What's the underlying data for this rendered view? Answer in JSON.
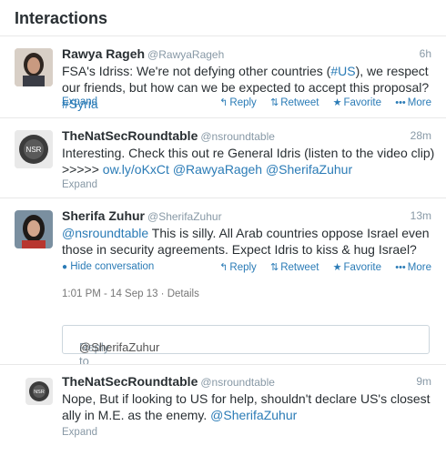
{
  "header": {
    "title": "Interactions"
  },
  "tweets": [
    {
      "name": "Rawya Rageh",
      "handle": "@RawyaRageh",
      "time": "6h",
      "text_parts": [
        "FSA's Idriss: We're not defying other countries (",
        "#US",
        "), we respect our friends, but how can we be expected to accept this proposal? ",
        "#Syria"
      ],
      "expand": "Expand",
      "actions": {
        "reply": "Reply",
        "retweet": "Retweet",
        "favorite": "Favorite",
        "more": "More"
      }
    },
    {
      "name": "TheNatSecRoundtable",
      "handle": "@nsroundtable",
      "time": "28m",
      "line1": "Interesting. Check this out re General Idris (listen to the video clip)",
      "line2_prefix": ">>>>> ",
      "link": "ow.ly/oKxCt",
      "mention1": "@RawyaRageh",
      "mention2": "@SherifaZuhur",
      "expand": "Expand",
      "avatar_text": "NSR"
    },
    {
      "name": "Sherifa Zuhur",
      "handle": "@SherifaZuhur",
      "time": "13m",
      "mention": "@nsroundtable",
      "text_rest": " This is silly.  All Arab countries oppose Israel even those in security agreements. Expect Idris to kiss & hug Israel?",
      "hide": "Hide conversation",
      "actions": {
        "reply": "Reply",
        "retweet": "Retweet",
        "favorite": "Favorite",
        "more": "More"
      },
      "meta": "1:01 PM - 14 Sep 13 · Details",
      "reply_prefix": "Reply to ",
      "reply_mention": "@SherifaZuhur"
    },
    {
      "name": "TheNatSecRoundtable",
      "handle": "@nsroundtable",
      "time": "9m",
      "text": "Nope, But if looking to US for help, shouldn't declare US's closest ally in M.E. as the enemy. ",
      "mention": "@SherifaZuhur",
      "expand": "Expand",
      "avatar_text": "NSR"
    }
  ],
  "colors": {
    "link": "#2a7bb6",
    "muted": "#8899a6",
    "text": "#292f33"
  }
}
